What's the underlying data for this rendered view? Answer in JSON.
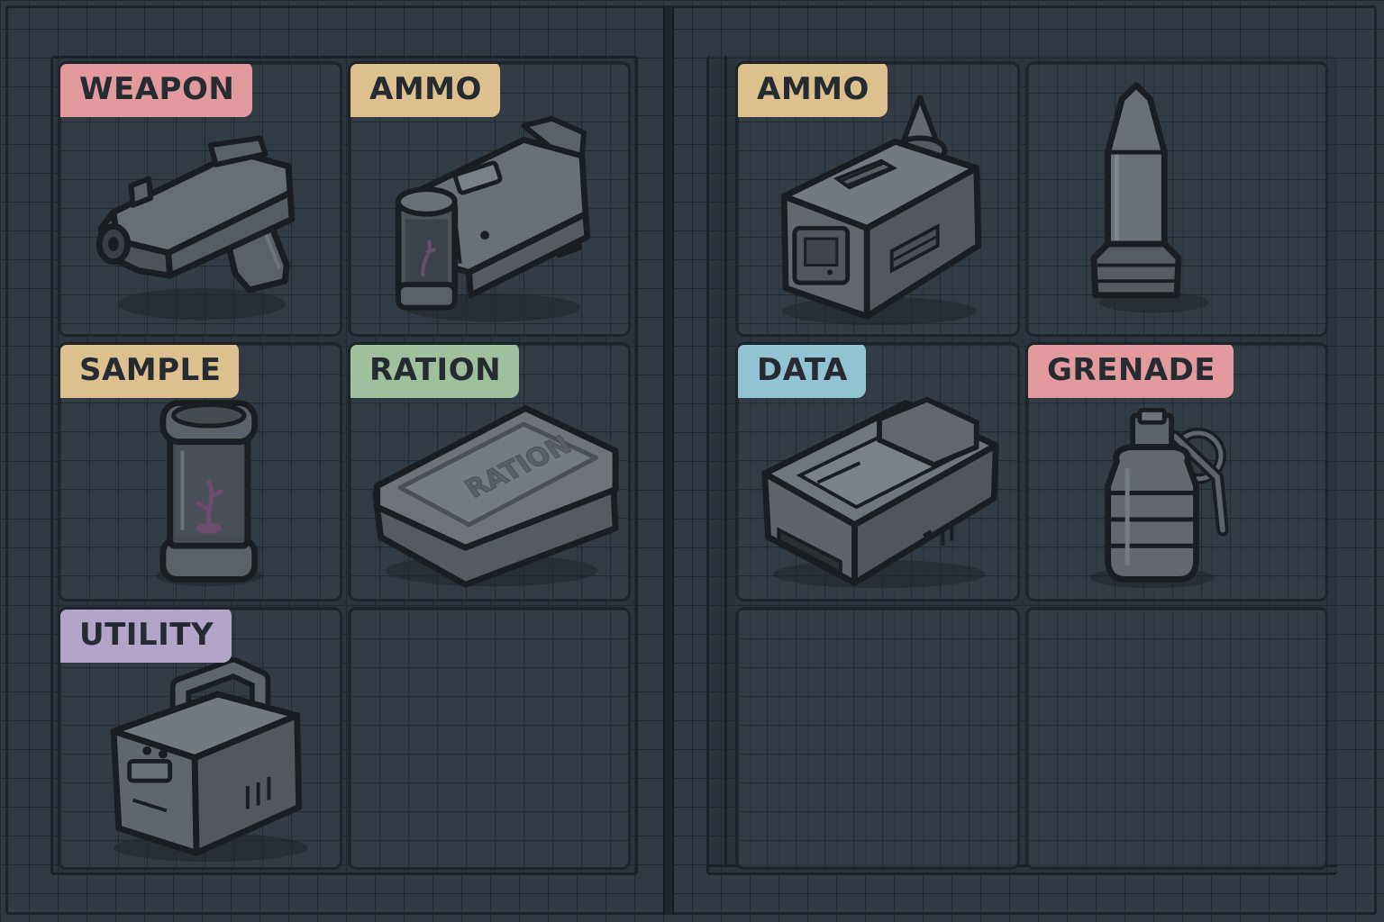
{
  "inventory": {
    "left_panel": {
      "slots": [
        {
          "tag": "WEAPON",
          "tag_color": "#e29a9e",
          "item_icon": "pistol-icon"
        },
        {
          "tag": "AMMO",
          "tag_color": "#dcc08e",
          "item_icon": "energy-cell-launcher-icon"
        },
        {
          "tag": "SAMPLE",
          "tag_color": "#dcc08e",
          "item_icon": "specimen-canister-icon"
        },
        {
          "tag": "RATION",
          "tag_color": "#9fbf9f",
          "item_icon": "ration-tin-icon",
          "item_text": "RATION"
        },
        {
          "tag": "UTILITY",
          "tag_color": "#b3a5c9",
          "item_icon": "toolbox-icon"
        },
        {
          "tag": "",
          "tag_color": "",
          "item_icon": ""
        }
      ]
    },
    "right_panel": {
      "slots": [
        {
          "tag": "AMMO",
          "tag_color": "#dcc08e",
          "item_icon": "ammo-box-icon"
        },
        {
          "tag": "",
          "tag_color": "",
          "item_icon": "bullet-icon"
        },
        {
          "tag": "DATA",
          "tag_color": "#92c3d3",
          "item_icon": "data-drive-icon"
        },
        {
          "tag": "GRENADE",
          "tag_color": "#e29a9e",
          "item_icon": "grenade-icon"
        },
        {
          "tag": "",
          "tag_color": "",
          "item_icon": ""
        },
        {
          "tag": "",
          "tag_color": "",
          "item_icon": ""
        }
      ]
    }
  }
}
